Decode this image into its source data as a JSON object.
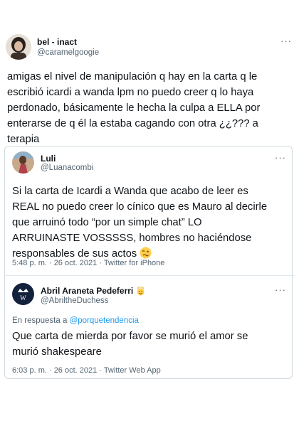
{
  "main_tweet": {
    "display_name": "bel - inact",
    "handle": "@caramelgoogie",
    "text_lines": [
      "amigas el nivel de manipulación q hay en la carta q le",
      "escribió icardi a wanda lpm no puedo creer q lo haya",
      "perdonado, básicamente le hecha la culpa a ELLA por",
      "enterarse de q él la estaba cagando con otra ¿¿??? a",
      "terapia"
    ]
  },
  "quoted_tweet": {
    "display_name": "Luli",
    "handle": "@Luanacombi",
    "text_lines": [
      "Si la carta de Icardi a Wanda que acabo de leer es",
      "REAL no puedo creer lo cínico que es Mauro al decirle",
      "que arruinó todo “por un simple chat” LO",
      "ARRUINASTE VOSSSSS, hombres no haciéndose",
      "responsables de sus actos"
    ],
    "emoji_icon": "woozy-face-emoji",
    "timestamp": "5:48 p. m. · 26 oct. 2021 · Twitter for iPhone"
  },
  "reply_tweet": {
    "display_name": "Abril Araneta Pedeferri",
    "name_emoji_icon": "angel-face-emoji",
    "handle": "@AbriltheDuchess",
    "reply_prefix": "En respuesta a",
    "reply_target": "@porquetendencia",
    "text_lines": [
      "Que carta de mierda por favor se murió el amor se",
      "murió shakespeare"
    ],
    "timestamp": "6:03 p. m. · 26 oct. 2021 · Twitter Web App"
  },
  "more_glyph": "···",
  "colors": {
    "link": "#1d9bf0",
    "secondary": "#536471",
    "border": "#cfd9de"
  }
}
